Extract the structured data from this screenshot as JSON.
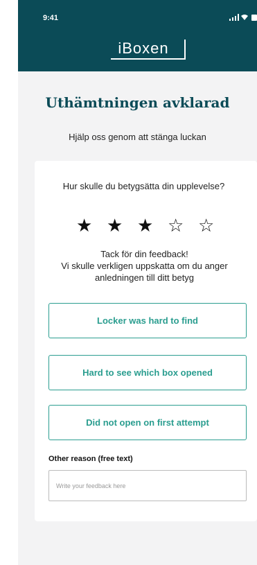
{
  "status_bar": {
    "time": "9:41",
    "icons": [
      "signal-icon",
      "wifi-icon",
      "battery-icon"
    ]
  },
  "header": {
    "logo_text": "iBoxen",
    "background": "#0b4b57"
  },
  "page": {
    "title": "Uthämtningen avklarad",
    "subtitle": "Hjälp oss genom att stänga luckan"
  },
  "rating_card": {
    "question": "Hur skulle du betygsätta din upplevelse?",
    "rating": 3,
    "max_rating": 5,
    "thanks_line1": "Tack för din feedback!",
    "thanks_line2": "Vi skulle verkligen uppskatta om du anger anledningen till ditt betyg",
    "reasons": [
      "Locker was hard to find",
      "Hard to see which box opened",
      "Did not open on first attempt"
    ],
    "other_reason_label": "Other reason (free text)",
    "other_reason_placeholder": "Write your feedback here"
  },
  "colors": {
    "accent": "#2a9d8f",
    "title": "#0b4b57"
  }
}
